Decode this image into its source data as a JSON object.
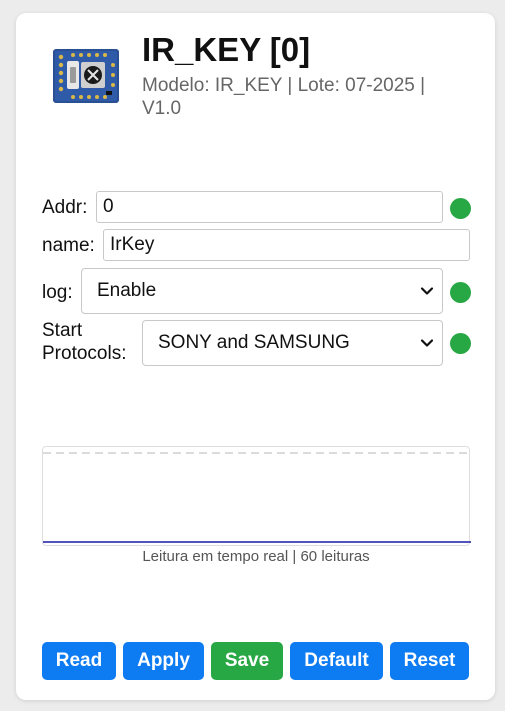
{
  "header": {
    "title": "IR_KEY [0]",
    "subtitle": "Modelo: IR_KEY | Lote: 07-2025 | V1.0",
    "image_icon": "ir-key-module-board-icon"
  },
  "fields": {
    "addr": {
      "label": "Addr:",
      "value": "0",
      "status_color": "#28a745"
    },
    "name": {
      "label": "name:",
      "value": "IrKey"
    },
    "log": {
      "label": "log:",
      "selected": "Enable",
      "status_color": "#28a745"
    },
    "start_protocols": {
      "label_line1": "Start",
      "label_line2": "Protocols:",
      "selected": "SONY and SAMSUNG",
      "status_color": "#28a745"
    }
  },
  "chart": {
    "caption": "Leitura em tempo real | 60 leituras",
    "readings": 60,
    "line_color": "#1a1aa6"
  },
  "buttons": {
    "read": "Read",
    "apply": "Apply",
    "save": "Save",
    "default": "Default",
    "reset": "Reset",
    "primary_color": "#0d7bf2",
    "save_color": "#28a745"
  }
}
